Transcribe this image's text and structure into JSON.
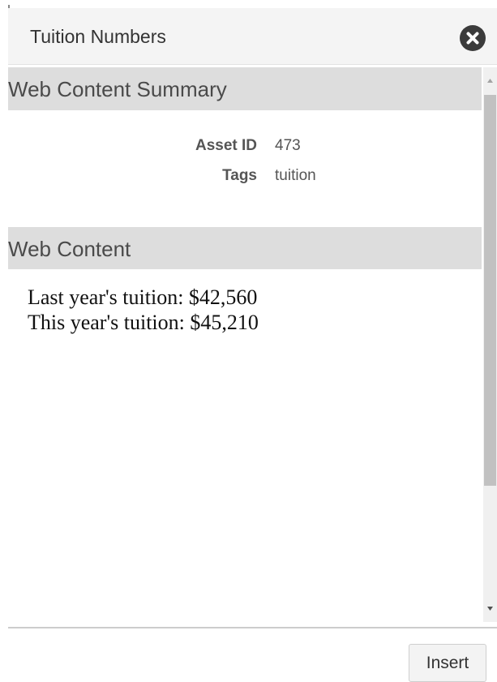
{
  "dialog": {
    "title": "Tuition Numbers",
    "close_icon": "close-circle-icon"
  },
  "summary": {
    "heading": "Web Content Summary",
    "fields": [
      {
        "label": "Asset ID",
        "value": "473"
      },
      {
        "label": "Tags",
        "value": "tuition"
      }
    ]
  },
  "web_content": {
    "heading": "Web Content",
    "lines": [
      "Last year's tuition: $42,560",
      "This year's tuition: $45,210"
    ]
  },
  "footer": {
    "insert_label": "Insert"
  },
  "colors": {
    "header_bg": "#f4f4f4",
    "section_bg": "#dddddd",
    "close_button": "#3b3b3b"
  }
}
